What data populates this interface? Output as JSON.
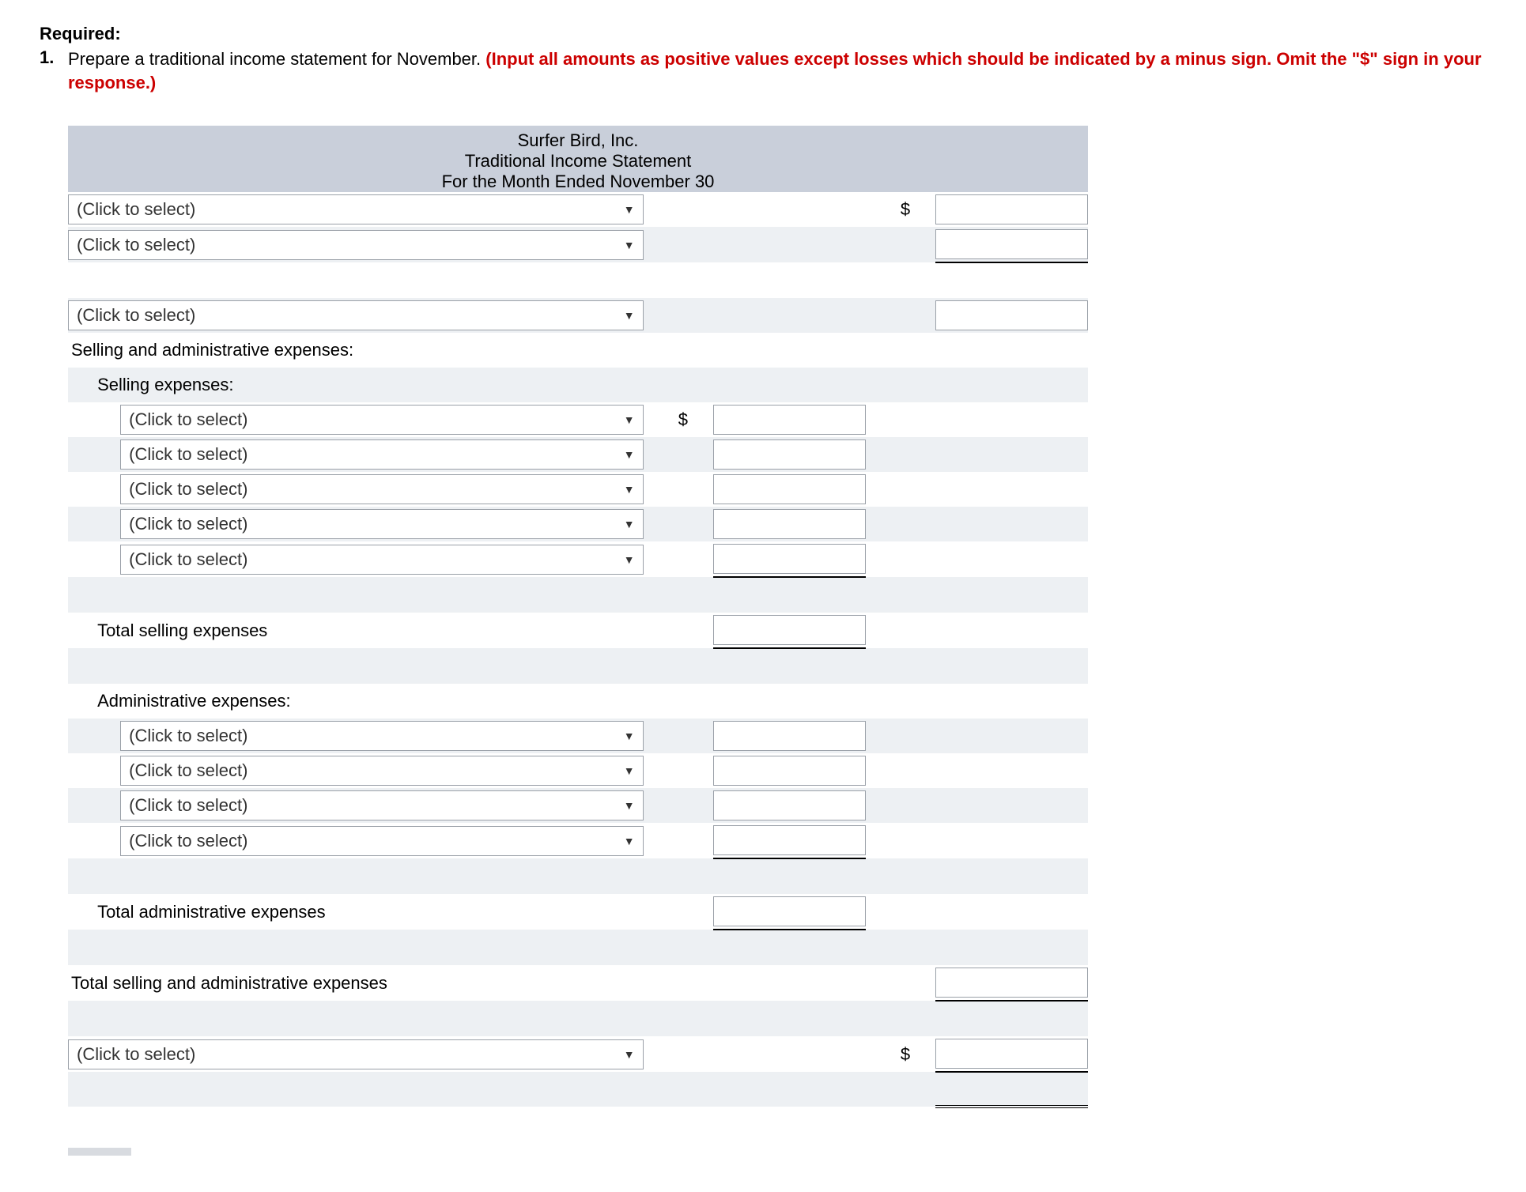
{
  "heading": "Required:",
  "question": {
    "number": "1.",
    "text_plain": "Prepare a traditional income statement for November. ",
    "text_red": "(Input all amounts as positive values except losses which should be indicated by a minus sign. Omit the \"$\" sign in your response.)"
  },
  "statement_header": {
    "company": "Surfer Bird, Inc.",
    "title": "Traditional Income Statement",
    "period": "For the Month Ended November 30"
  },
  "placeholders": {
    "select": "(Click to select)"
  },
  "symbols": {
    "dollar": "$"
  },
  "labels": {
    "selling_admin_expenses": "Selling and administrative expenses:",
    "selling_expenses": "Selling expenses:",
    "total_selling_expenses": "Total selling expenses",
    "admin_expenses": "Administrative expenses:",
    "total_admin_expenses": "Total administrative expenses",
    "total_selling_admin_expenses": "Total selling and administrative expenses"
  }
}
